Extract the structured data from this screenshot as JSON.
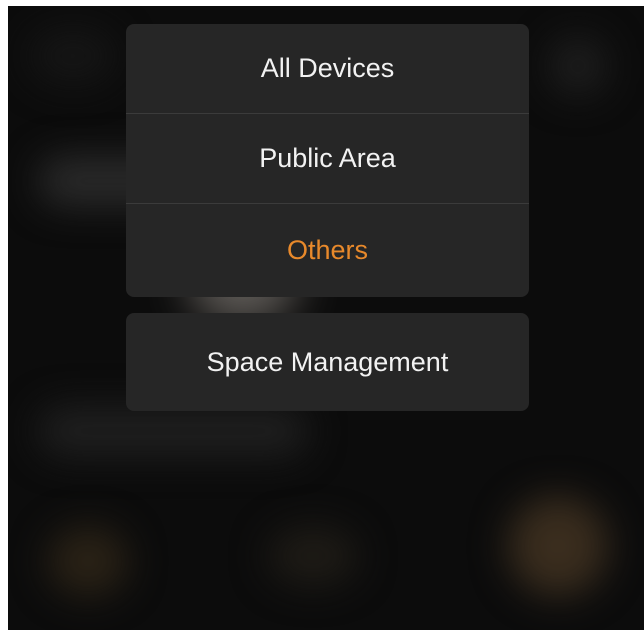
{
  "menu": {
    "items": [
      {
        "label": "All Devices"
      },
      {
        "label": "Public Area"
      },
      {
        "label": "Others"
      }
    ],
    "selected_index": 2
  },
  "actions": {
    "space_management_label": "Space Management"
  },
  "colors": {
    "selected_text": "#e8892b",
    "menu_background": "#262626",
    "menu_text": "#f2f2f2"
  }
}
